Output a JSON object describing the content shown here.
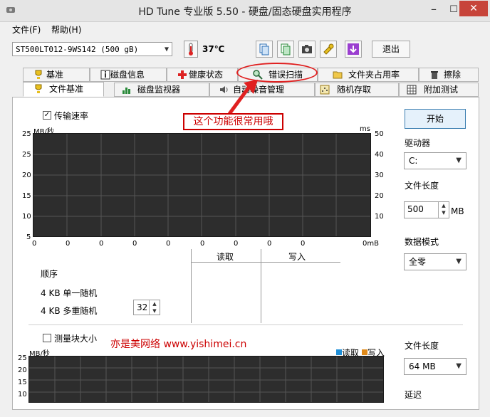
{
  "window": {
    "title": "HD Tune 专业版 5.50 - 硬盘/固态硬盘实用程序"
  },
  "menu": {
    "file": "文件(F)",
    "help": "帮助(H)"
  },
  "toolbar": {
    "drive": "ST500LT012-9WS142 (500 gB)",
    "temperature": "37℃",
    "exit": "退出",
    "buttons": [
      "copy-icon",
      "copy-screen-icon",
      "camera-icon",
      "options-icon",
      "download-icon"
    ]
  },
  "tabs": {
    "row1": [
      "基准",
      "磁盘信息",
      "健康状态",
      "错误扫描",
      "文件夹占用率",
      "擦除"
    ],
    "row2": [
      "文件基准",
      "磁盘监视器",
      "自动噪音管理",
      "随机存取",
      "附加测试"
    ],
    "active": "文件基准"
  },
  "annotation": {
    "callout": "这个功能很常用哦",
    "circled_tab": "错误扫描"
  },
  "benchmark": {
    "transfer_rate_label": "传输速率",
    "transfer_rate_checked": true,
    "y_unit_left": "MB/秒",
    "y_unit_right": "ms",
    "y_ticks_left": [
      "25",
      "20",
      "15",
      "10",
      "5"
    ],
    "y_ticks_right": [
      "50",
      "40",
      "30",
      "20",
      "10"
    ],
    "x_ticks": [
      "0",
      "0",
      "0",
      "0",
      "0",
      "0",
      "0",
      "0",
      "0",
      "0mB"
    ]
  },
  "results": {
    "col_read": "读取",
    "col_write": "写入",
    "row_sequential": "顺序",
    "row_4k_single": "4 KB 单一随机",
    "row_4k_multi": "4 KB 多重随机",
    "queue_depth": "32"
  },
  "right_panel": {
    "start": "开始",
    "drive_label": "驱动器",
    "drive_value": "C:",
    "file_length_label": "文件长度",
    "file_length_value": "500",
    "file_length_unit": "MB",
    "data_mode_label": "数据模式",
    "data_mode_value": "全零"
  },
  "block_size": {
    "label": "测量块大小",
    "checked": false,
    "y_unit": "MB/秒",
    "y_ticks": [
      "25",
      "20",
      "15",
      "10"
    ],
    "legend_read": "读取",
    "legend_write": "写入",
    "file_length_label": "文件长度",
    "file_length_value": "64 MB",
    "delay_label": "延迟"
  },
  "watermark": "亦是美网络 www.yishimei.cn",
  "colors": {
    "accent_red": "#cc0000",
    "chart_bg": "#2d2d2d",
    "grid": "#555555",
    "read": "#1f8fd8",
    "write": "#e08a1a"
  }
}
